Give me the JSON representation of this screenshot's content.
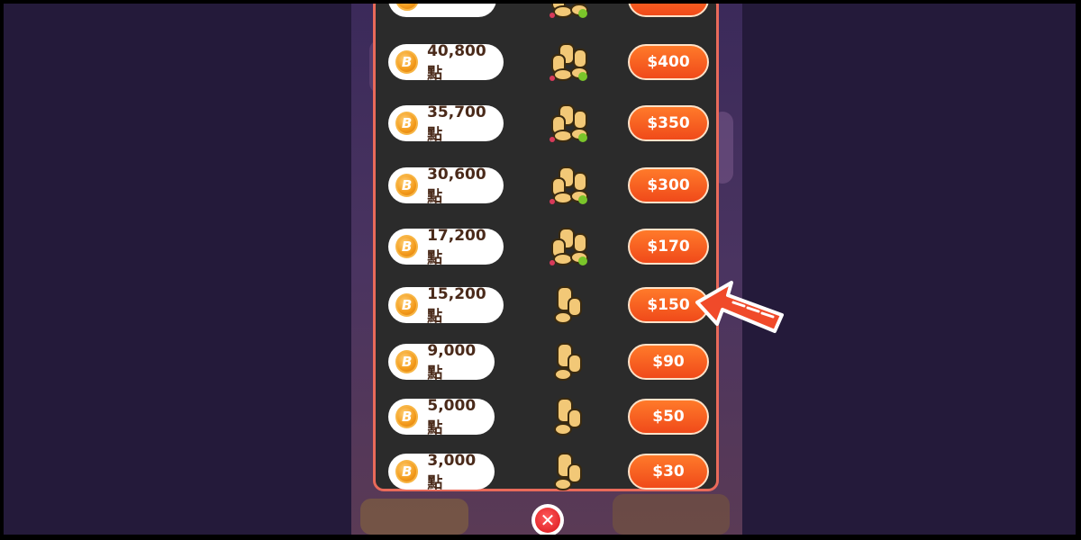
{
  "shop": {
    "rows": [
      {
        "points": "",
        "price": ""
      },
      {
        "points": "40,800 點",
        "price": "$400"
      },
      {
        "points": "35,700 點",
        "price": "$350"
      },
      {
        "points": "30,600 點",
        "price": "$300"
      },
      {
        "points": "17,200 點",
        "price": "$170"
      },
      {
        "points": "15,200 點",
        "price": "$150"
      },
      {
        "points": "9,000 點",
        "price": "$90"
      },
      {
        "points": "5,000 點",
        "price": "$50"
      },
      {
        "points": "3,000 點",
        "price": "$30"
      }
    ],
    "coin_symbol": "B",
    "close_symbol": "✕"
  },
  "colors": {
    "price_button": "#f0521a",
    "panel_border": "#e96a5a",
    "panel_bg": "#2b2b2b",
    "arrow": "#f04a2a"
  },
  "icons": {
    "coin": "coin-icon",
    "pile": "coin-pile-icon",
    "close": "close-icon",
    "arrow": "pointer-arrow-icon"
  }
}
